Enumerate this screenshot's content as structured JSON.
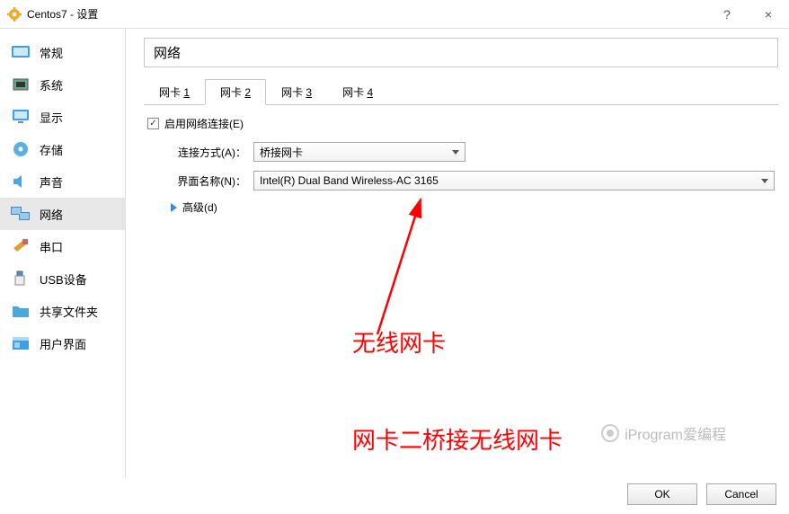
{
  "window": {
    "title": "Centos7 - 设置",
    "help": "?",
    "close": "×"
  },
  "sidebar": {
    "items": [
      {
        "label": "常规",
        "icon": "general",
        "color": "#3aa0e8"
      },
      {
        "label": "系统",
        "icon": "system",
        "color": "#555"
      },
      {
        "label": "显示",
        "icon": "display",
        "color": "#3aa0e8"
      },
      {
        "label": "存储",
        "icon": "storage",
        "color": "#5bb0de"
      },
      {
        "label": "声音",
        "icon": "audio",
        "color": "#4aa8dc"
      },
      {
        "label": "网络",
        "icon": "network",
        "color": "#3b8bd4",
        "active": true
      },
      {
        "label": "串口",
        "icon": "serial",
        "color": "#e0a030"
      },
      {
        "label": "USB设备",
        "icon": "usb",
        "color": "#888"
      },
      {
        "label": "共享文件夹",
        "icon": "folder",
        "color": "#4aa8dc"
      },
      {
        "label": "用户界面",
        "icon": "ui",
        "color": "#3aa0e8"
      }
    ]
  },
  "page": {
    "title": "网络",
    "tabs": [
      {
        "pre": "网卡 ",
        "num": "1"
      },
      {
        "pre": "网卡 ",
        "num": "2",
        "active": true
      },
      {
        "pre": "网卡 ",
        "num": "3"
      },
      {
        "pre": "网卡 ",
        "num": "4"
      }
    ],
    "enable_checked": true,
    "enable_label_a": "启用网络连接(",
    "enable_label_u": "E",
    "enable_label_b": ")",
    "conn_label_a": "连接方式(",
    "conn_label_u": "A",
    "conn_label_b": ")：",
    "conn_value": "桥接网卡",
    "iface_label_a": "界面名称(",
    "iface_label_u": "N",
    "iface_label_b": ")：",
    "iface_value": "Intel(R) Dual Band Wireless-AC 3165",
    "advanced_a": "高级(",
    "advanced_u": "d",
    "advanced_b": ")"
  },
  "annotations": {
    "label1": "无线网卡",
    "label2": "网卡二桥接无线网卡"
  },
  "watermark": "iProgram爱编程",
  "buttons": {
    "ok": "OK",
    "cancel": "Cancel"
  }
}
